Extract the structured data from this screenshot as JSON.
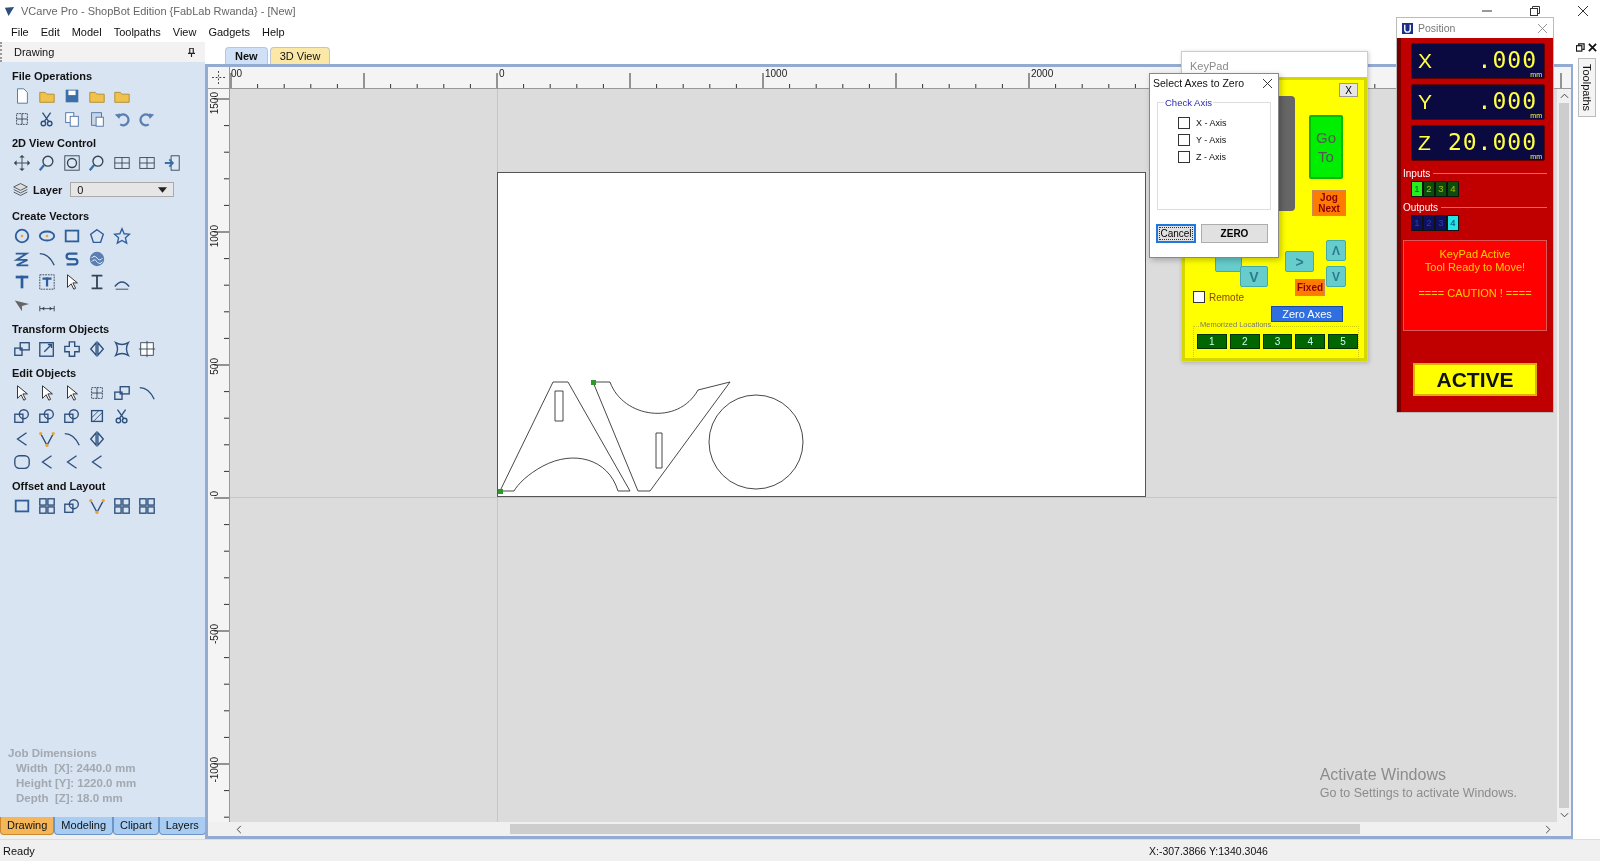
{
  "window": {
    "title": "VCarve Pro - ShopBot Edition {FabLab Rwanda} - [New]"
  },
  "menu": [
    "File",
    "Edit",
    "Model",
    "Toolpaths",
    "View",
    "Gadgets",
    "Help"
  ],
  "panel": {
    "title": "Drawing",
    "sections": [
      {
        "kind": "icons",
        "title": "File Operations"
      },
      {
        "kind": "icons",
        "title": "2D View Control"
      },
      {
        "kind": "layer",
        "title": "Layer",
        "value": "0"
      },
      {
        "kind": "icons",
        "title": "Create Vectors"
      },
      {
        "kind": "icons",
        "title": "Transform Objects"
      },
      {
        "kind": "icons",
        "title": "Edit Objects"
      },
      {
        "kind": "icons",
        "title": "Offset and Layout"
      }
    ],
    "job_dimensions": {
      "title": "Job Dimensions",
      "lines": [
        "Width  [X]: 2440.0 mm",
        "Height [Y]: 1220.0 mm",
        "Depth  [Z]: 18.0 mm"
      ]
    },
    "tabs": [
      {
        "label": "Drawing",
        "selected": true
      },
      {
        "label": "Modeling",
        "selected": false
      },
      {
        "label": "Clipart",
        "selected": false
      },
      {
        "label": "Layers",
        "selected": false
      }
    ]
  },
  "view_tabs": [
    {
      "label": "New",
      "selected": true
    },
    {
      "label": "3D View",
      "selected": false
    }
  ],
  "ruler": {
    "x_labels": [
      "00",
      "0",
      "1000",
      "2000"
    ],
    "y_labels": [
      "1500",
      "1000",
      "500",
      "0",
      "-500",
      "-1000"
    ]
  },
  "side_tab": "Toolpaths",
  "activation_notice": {
    "title": "Activate Windows",
    "text": "Go to Settings to activate Windows."
  },
  "keypad": {
    "title": "KeyPad",
    "close": "X",
    "go_to": "Go To",
    "jog_next": "Jog Next",
    "arrows": [
      {
        "kind": "blank",
        "label": ""
      },
      {
        "kind": "down",
        "label": "V"
      },
      {
        "kind": "right",
        "label": ">"
      },
      {
        "kind": "up",
        "label": "Λ"
      },
      {
        "kind": "zdown",
        "label": "V"
      }
    ],
    "fixed": "Fixed",
    "remote": {
      "label": "Remote",
      "checked": false
    },
    "zero_axes": "Zero Axes",
    "memorized_label": "Memorized Locations",
    "memorized": [
      "1",
      "2",
      "3",
      "4",
      "5"
    ]
  },
  "dialog": {
    "title": "Select Axes to Zero",
    "group": "Check Axis",
    "axes": [
      {
        "label": "X - Axis",
        "checked": false
      },
      {
        "label": "Y - Axis",
        "checked": false
      },
      {
        "label": "Z - Axis",
        "checked": false
      }
    ],
    "buttons": [
      {
        "label": "Cancel",
        "focused": true
      },
      {
        "label": "ZERO",
        "focused": false
      }
    ]
  },
  "position": {
    "title": "Position",
    "axes": [
      {
        "axis": "X",
        "value": ".000",
        "unit": "mm"
      },
      {
        "axis": "Y",
        "value": ".000",
        "unit": "mm"
      },
      {
        "axis": "Z",
        "value": "20.000",
        "unit": "mm"
      }
    ],
    "inputs": {
      "label": "Inputs",
      "items": [
        {
          "label": "1",
          "on": true
        },
        {
          "label": "2",
          "on": false
        },
        {
          "label": "3",
          "on": false
        },
        {
          "label": "4",
          "on": false
        }
      ]
    },
    "outputs": {
      "label": "Outputs",
      "items": [
        {
          "label": "1",
          "on": false
        },
        {
          "label": "2",
          "on": false
        },
        {
          "label": "3",
          "on": false
        },
        {
          "label": "4",
          "on": true
        }
      ]
    },
    "message": {
      "lines": [
        "KeyPad Active",
        "Tool Ready to Move!"
      ],
      "warning": "==== CAUTION ! ===="
    },
    "status": "ACTIVE"
  },
  "status_bar": {
    "text": "Ready",
    "coordinates": "X:-307.3866 Y:1340.3046"
  }
}
